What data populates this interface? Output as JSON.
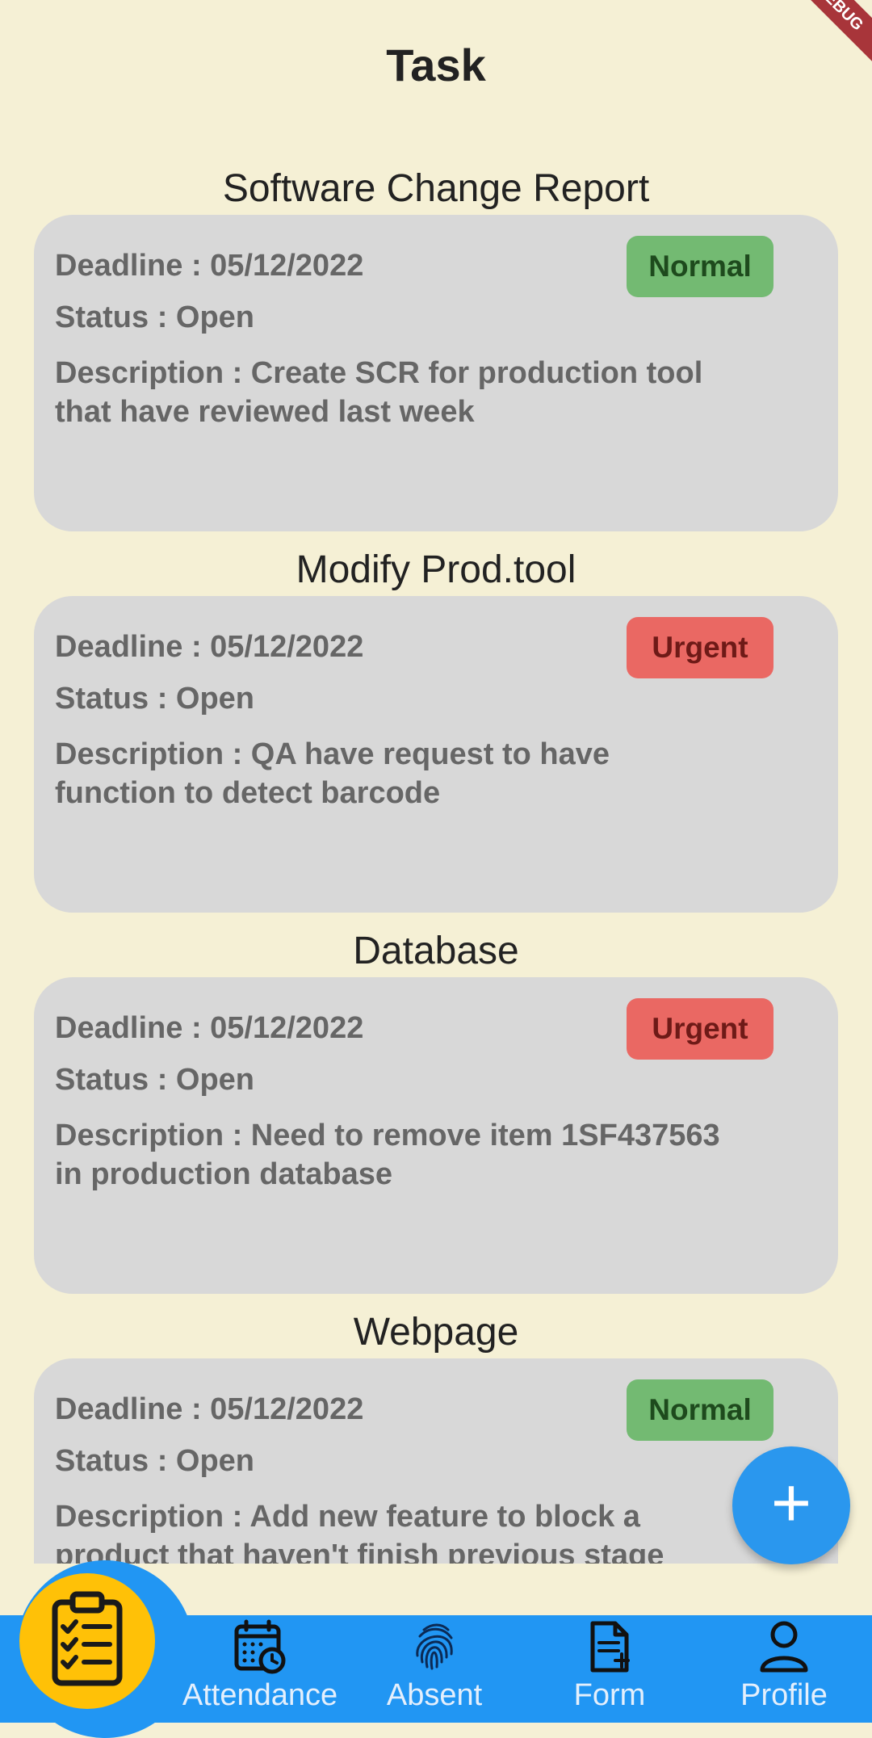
{
  "app": {
    "title": "Task",
    "debug_banner": "DEBUG"
  },
  "tasks": [
    {
      "heading": "Software Change Report",
      "deadline": "Deadline : 05/12/2022",
      "status": "Status : Open",
      "description": "Description : Create SCR for production tool that have reviewed last week",
      "priority": "Normal"
    },
    {
      "heading": "Modify Prod.tool",
      "deadline": "Deadline : 05/12/2022",
      "status": "Status : Open",
      "description": "Description : QA have request to have function to detect barcode",
      "priority": "Urgent"
    },
    {
      "heading": "Database",
      "deadline": "Deadline : 05/12/2022",
      "status": "Status : Open",
      "description": "Description : Need to remove item 1SF437563 in production database",
      "priority": "Urgent"
    },
    {
      "heading": "Webpage",
      "deadline": "Deadline : 05/12/2022",
      "status": "Status : Open",
      "description": "Description : Add new feature to block a product that haven't finish previous stage",
      "priority": "Normal"
    }
  ],
  "fab": {
    "icon": "plus-icon",
    "label": "+"
  },
  "bottom_nav": {
    "items": [
      {
        "label": "",
        "icon": "clipboard-checklist-icon",
        "active": true
      },
      {
        "label": "Attendance",
        "icon": "calendar-clock-icon"
      },
      {
        "label": "Absent",
        "icon": "fingerprint-icon"
      },
      {
        "label": "Form",
        "icon": "document-add-icon"
      },
      {
        "label": "Profile",
        "icon": "person-icon"
      }
    ]
  },
  "colors": {
    "background": "#F5F0D5",
    "card": "#D8D8D8",
    "normal_badge": "#73BA72",
    "urgent_badge": "#EA6863",
    "nav_bar": "#2196F3",
    "nav_active": "#FFC107",
    "fab": "#2A97EE"
  }
}
